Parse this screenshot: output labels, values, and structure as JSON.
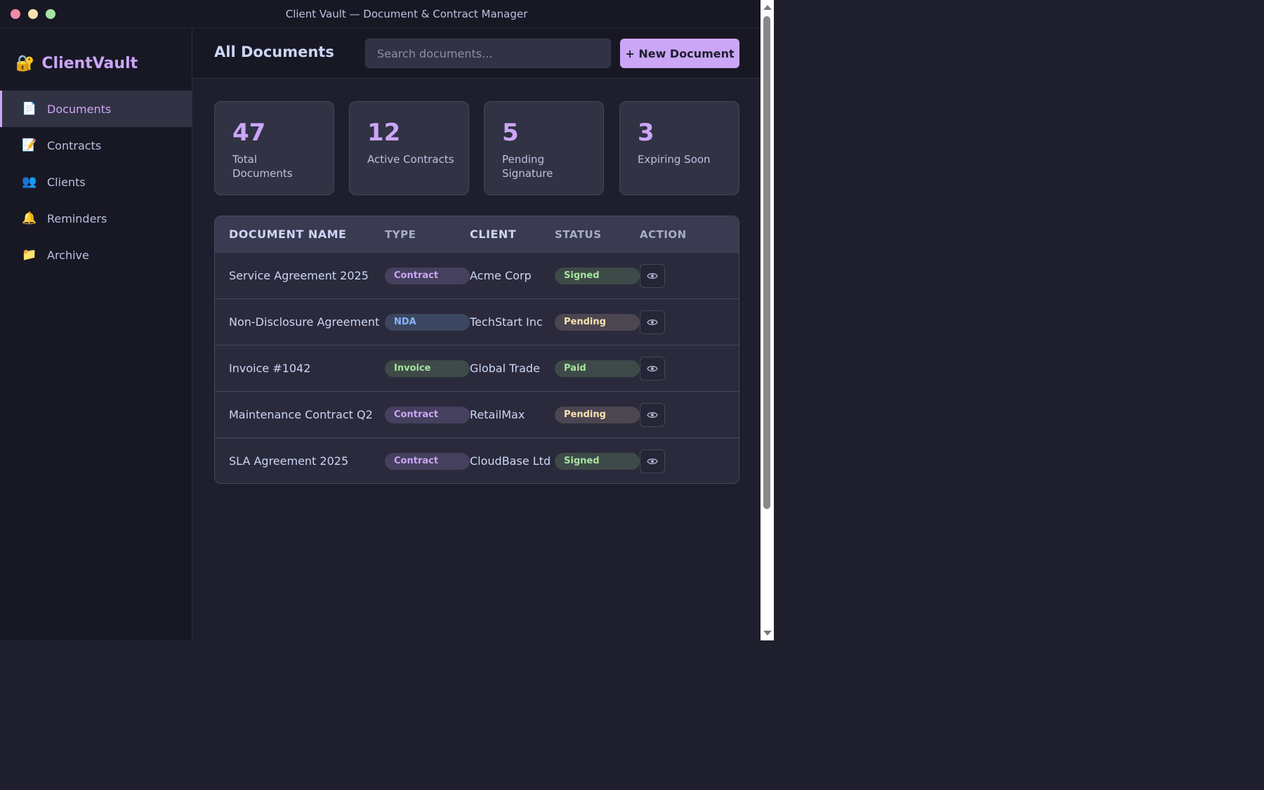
{
  "window": {
    "title": "Client Vault — Document & Contract Manager"
  },
  "brand": {
    "icon": "🔐",
    "name": "ClientVault"
  },
  "sidebar": {
    "items": [
      {
        "icon": "📄",
        "label": "Documents"
      },
      {
        "icon": "📝",
        "label": "Contracts"
      },
      {
        "icon": "👥",
        "label": "Clients"
      },
      {
        "icon": "🔔",
        "label": "Reminders"
      },
      {
        "icon": "📁",
        "label": "Archive"
      }
    ],
    "active": "Documents"
  },
  "header": {
    "title": "All Documents",
    "search_placeholder": "Search documents...",
    "new_button": "+ New Document"
  },
  "stats": [
    {
      "value": "47",
      "label": "Total Documents"
    },
    {
      "value": "12",
      "label": "Active Contracts"
    },
    {
      "value": "5",
      "label": "Pending Signature"
    },
    {
      "value": "3",
      "label": "Expiring Soon"
    }
  ],
  "table": {
    "columns": [
      "DOCUMENT NAME",
      "TYPE",
      "CLIENT",
      "STATUS",
      "ACTION"
    ],
    "rows": [
      {
        "name": "Service Agreement 2025",
        "type": "Contract",
        "client": "Acme Corp",
        "status": "Signed"
      },
      {
        "name": "Non-Disclosure Agreement",
        "type": "NDA",
        "client": "TechStart Inc",
        "status": "Pending"
      },
      {
        "name": "Invoice #1042",
        "type": "Invoice",
        "client": "Global Trade",
        "status": "Paid"
      },
      {
        "name": "Maintenance Contract Q2",
        "type": "Contract",
        "client": "RetailMax",
        "status": "Pending"
      },
      {
        "name": "SLA Agreement 2025",
        "type": "Contract",
        "client": "CloudBase Ltd",
        "status": "Signed"
      }
    ]
  },
  "colors": {
    "accent": "#cba6f7",
    "background": "#1e1e2e",
    "sidebar": "#181825",
    "signed": "#a6e3a1",
    "pending": "#f9e2af",
    "nda": "#89b4fa"
  }
}
